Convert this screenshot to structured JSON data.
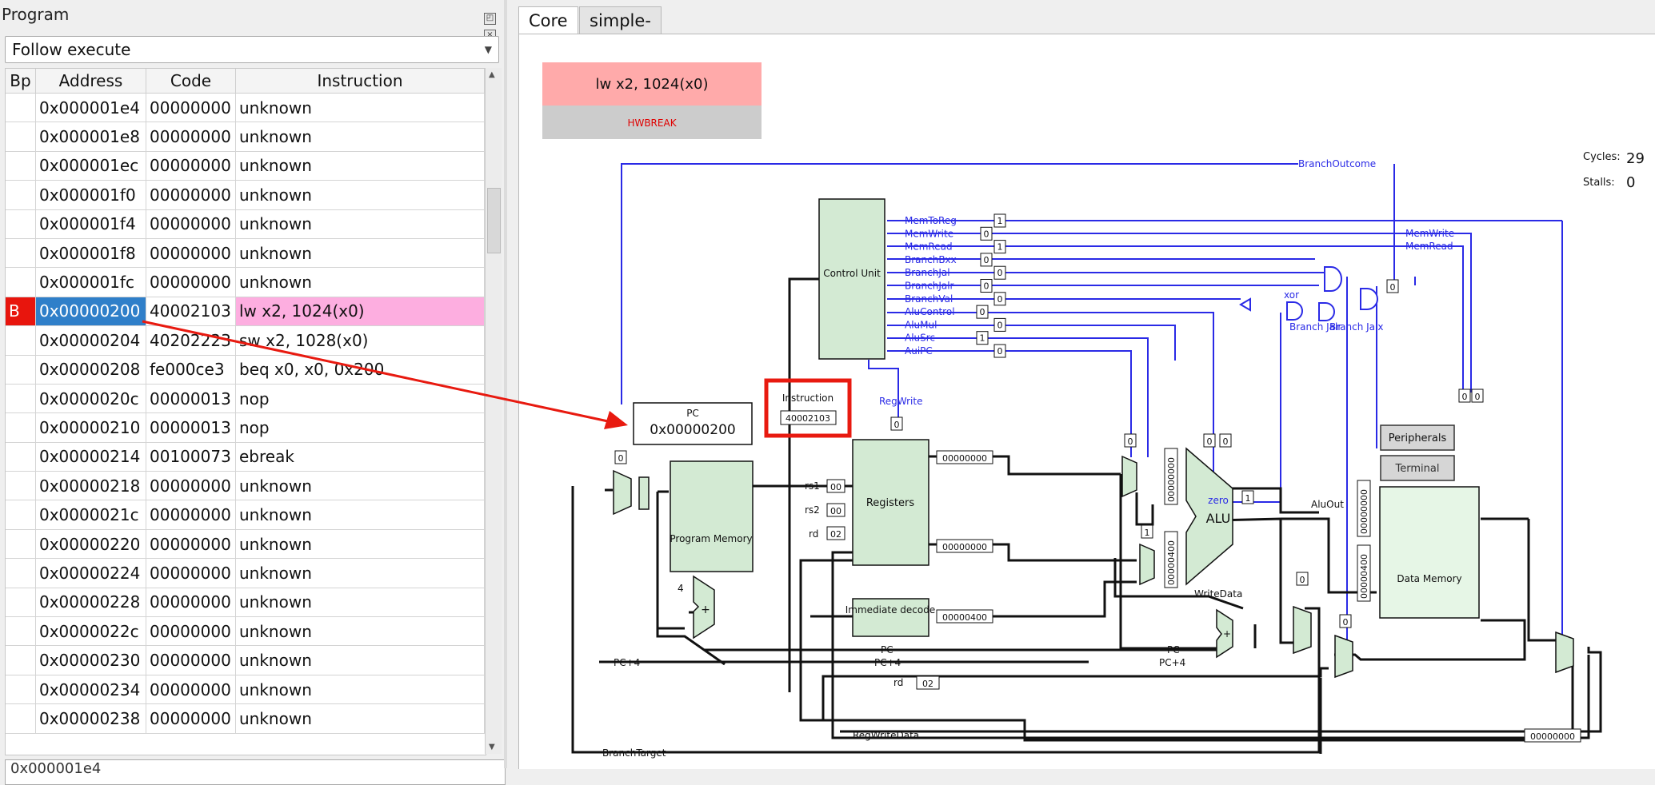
{
  "program_panel": {
    "title": "Program",
    "follow_mode": "Follow execute",
    "columns": [
      "Bp",
      "Address",
      "Code",
      "Instruction"
    ],
    "rows": [
      {
        "bp": "",
        "address": "0x000001e4",
        "code": "00000000",
        "instruction": "unknown"
      },
      {
        "bp": "",
        "address": "0x000001e8",
        "code": "00000000",
        "instruction": "unknown"
      },
      {
        "bp": "",
        "address": "0x000001ec",
        "code": "00000000",
        "instruction": "unknown"
      },
      {
        "bp": "",
        "address": "0x000001f0",
        "code": "00000000",
        "instruction": "unknown"
      },
      {
        "bp": "",
        "address": "0x000001f4",
        "code": "00000000",
        "instruction": "unknown"
      },
      {
        "bp": "",
        "address": "0x000001f8",
        "code": "00000000",
        "instruction": "unknown"
      },
      {
        "bp": "",
        "address": "0x000001fc",
        "code": "00000000",
        "instruction": "unknown"
      },
      {
        "bp": "B",
        "address": "0x00000200",
        "code": "40002103",
        "instruction": "lw x2, 1024(x0)"
      },
      {
        "bp": "",
        "address": "0x00000204",
        "code": "40202223",
        "instruction": "sw x2, 1028(x0)"
      },
      {
        "bp": "",
        "address": "0x00000208",
        "code": "fe000ce3",
        "instruction": "beq x0, x0, 0x200"
      },
      {
        "bp": "",
        "address": "0x0000020c",
        "code": "00000013",
        "instruction": "nop"
      },
      {
        "bp": "",
        "address": "0x00000210",
        "code": "00000013",
        "instruction": "nop"
      },
      {
        "bp": "",
        "address": "0x00000214",
        "code": "00100073",
        "instruction": "ebreak"
      },
      {
        "bp": "",
        "address": "0x00000218",
        "code": "00000000",
        "instruction": "unknown"
      },
      {
        "bp": "",
        "address": "0x0000021c",
        "code": "00000000",
        "instruction": "unknown"
      },
      {
        "bp": "",
        "address": "0x00000220",
        "code": "00000000",
        "instruction": "unknown"
      },
      {
        "bp": "",
        "address": "0x00000224",
        "code": "00000000",
        "instruction": "unknown"
      },
      {
        "bp": "",
        "address": "0x00000228",
        "code": "00000000",
        "instruction": "unknown"
      },
      {
        "bp": "",
        "address": "0x0000022c",
        "code": "00000000",
        "instruction": "unknown"
      },
      {
        "bp": "",
        "address": "0x00000230",
        "code": "00000000",
        "instruction": "unknown"
      },
      {
        "bp": "",
        "address": "0x00000234",
        "code": "00000000",
        "instruction": "unknown"
      },
      {
        "bp": "",
        "address": "0x00000238",
        "code": "00000000",
        "instruction": "unknown"
      }
    ],
    "footer_value": "0x000001e4"
  },
  "tabs": [
    {
      "label": "Core",
      "active": true
    },
    {
      "label": "simple-lw-sw-ia.S",
      "active": false
    }
  ],
  "core": {
    "current_instruction": "lw x2, 1024(x0)",
    "status": "HWBREAK",
    "cycles_label": "Cycles:",
    "cycles_value": "29",
    "stalls_label": "Stalls:",
    "stalls_value": "0",
    "pc_label": "PC",
    "pc_value": "0x00000200",
    "instruction_label": "Instruction",
    "instruction_value": "40002103",
    "control_unit": "Control Unit",
    "program_memory": "Program Memory",
    "registers": "Registers",
    "immediate_decode": "Immediate decode",
    "alu": "ALU",
    "zero": "zero",
    "data_memory": "Data Memory",
    "peripherals": "Peripherals",
    "terminal": "Terminal",
    "regwrite": "RegWrite",
    "branch_outcome": "BranchOutcome",
    "branch_jalr": "Branch Jalr",
    "branch_jalx": "Branch Jalx",
    "xor": "xor",
    "mem_write": "MemWrite",
    "mem_read": "MemRead",
    "alu_out": "AluOut",
    "write_data": "WriteData",
    "reg_write_data": "RegWriteData",
    "branch_target": "BranchTarget",
    "pc4_label": "PC+4",
    "pc_short": "PC",
    "rs1": "rs1",
    "rs2": "rs2",
    "rd": "rd",
    "rs1_val": "00",
    "rs2_val": "00",
    "rd_val": "02",
    "rd_val2": "02",
    "reg_out1": "00000000",
    "reg_out2": "00000000",
    "imm_val": "00000400",
    "alu_in_a": "00000000",
    "alu_in_b": "00000400",
    "mem_in_a": "00000000",
    "mem_in_b": "00000400",
    "wb_val": "00000000",
    "four": "4",
    "plus": "+",
    "control_signals": [
      {
        "name": "MemToReg",
        "value": "1"
      },
      {
        "name": "MemWrite",
        "value": "0"
      },
      {
        "name": "MemRead",
        "value": "1"
      },
      {
        "name": "BranchBxx",
        "value": "0"
      },
      {
        "name": "BranchJal",
        "value": "0"
      },
      {
        "name": "BranchJalr",
        "value": "0"
      },
      {
        "name": "BranchVal",
        "value": "0"
      },
      {
        "name": "AluControl",
        "value": "0"
      },
      {
        "name": "AluMul",
        "value": "0"
      },
      {
        "name": "AluSrc",
        "value": "1"
      },
      {
        "name": "AuiPC",
        "value": "0"
      }
    ],
    "small_values": {
      "regwrite": "0",
      "pc_mux": "0",
      "alu_mux_a": "0",
      "alu_mux_b": "1",
      "alu_ctl_a": "0",
      "alu_ctl_b": "0",
      "zero_out": "1",
      "branch_out": "0",
      "mem_ctl_a": "0",
      "mem_ctl_b": "0",
      "wb_sel": "0",
      "wb_mux": "0"
    }
  }
}
